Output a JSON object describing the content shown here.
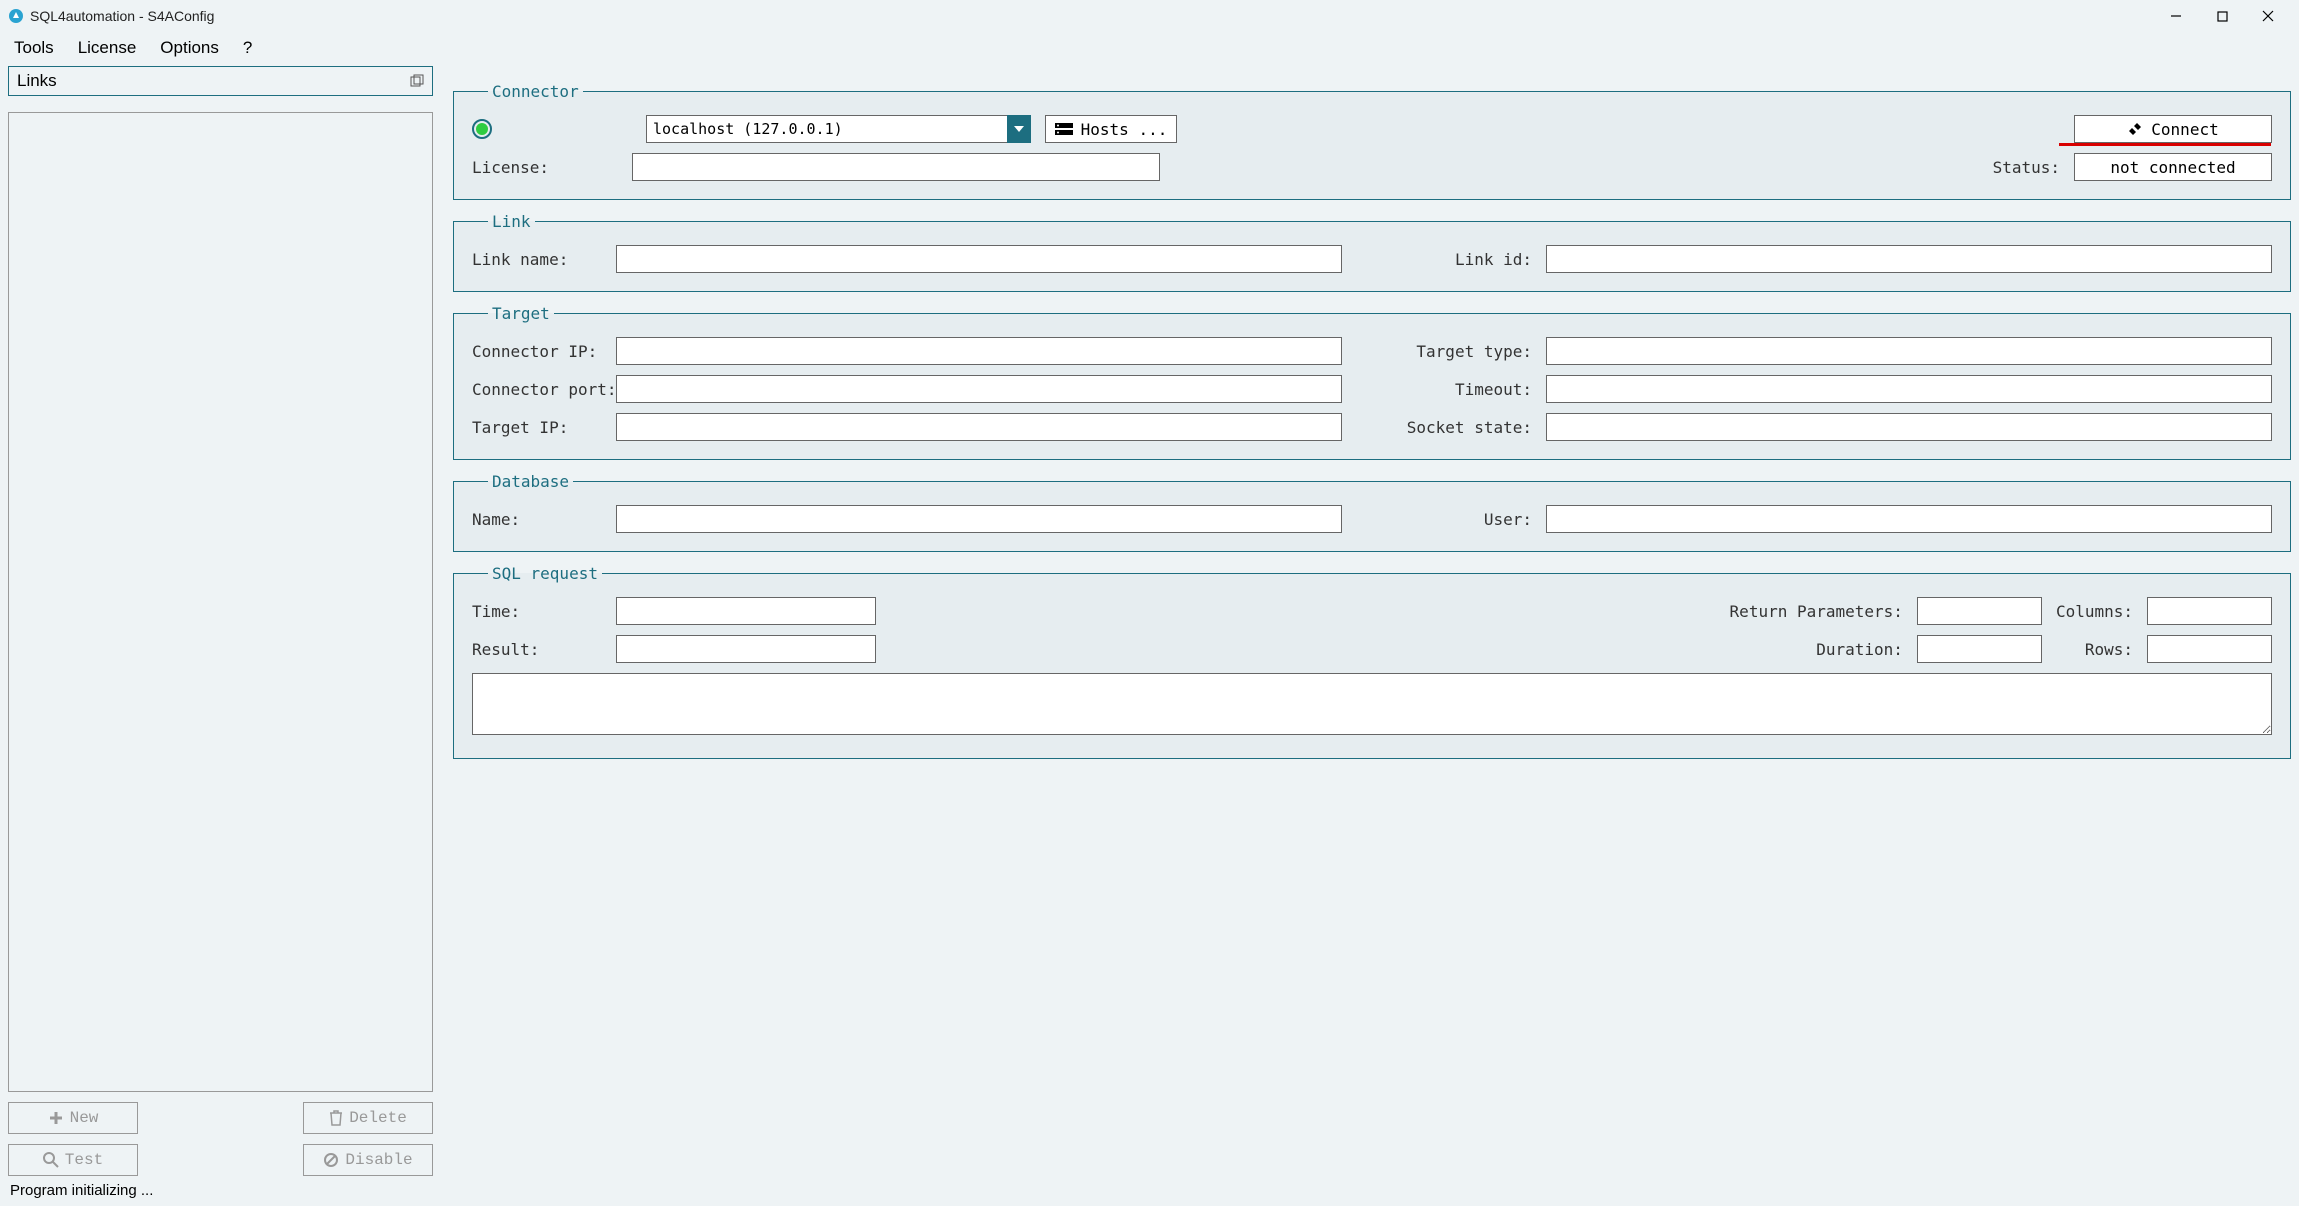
{
  "title": "SQL4automation - S4AConfig",
  "menu": {
    "tools": "Tools",
    "license": "License",
    "options": "Options",
    "help": "?"
  },
  "sidebar": {
    "header": "Links",
    "buttons": {
      "new": "New",
      "delete": "Delete",
      "test": "Test",
      "disable": "Disable"
    }
  },
  "connector": {
    "legend": "Connector",
    "host_value": "localhost (127.0.0.1)",
    "hosts_btn": "Hosts ...",
    "connect_btn": "Connect",
    "license_label": "License:",
    "license_value": "",
    "status_label": "Status:",
    "status_value": "not connected"
  },
  "link": {
    "legend": "Link",
    "name_label": "Link name:",
    "name_value": "",
    "id_label": "Link id:",
    "id_value": ""
  },
  "target": {
    "legend": "Target",
    "connector_ip_label": "Connector IP:",
    "connector_ip_value": "",
    "connector_port_label": "Connector port:",
    "connector_port_value": "",
    "target_ip_label": "Target IP:",
    "target_ip_value": "",
    "target_type_label": "Target type:",
    "target_type_value": "",
    "timeout_label": "Timeout:",
    "timeout_value": "",
    "socket_state_label": "Socket state:",
    "socket_state_value": ""
  },
  "database": {
    "legend": "Database",
    "name_label": "Name:",
    "name_value": "",
    "user_label": "User:",
    "user_value": ""
  },
  "sql": {
    "legend": "SQL request",
    "time_label": "Time:",
    "time_value": "",
    "result_label": "Result:",
    "result_value": "",
    "return_params_label": "Return Parameters:",
    "return_params_value": "",
    "duration_label": "Duration:",
    "duration_value": "",
    "columns_label": "Columns:",
    "columns_value": "",
    "rows_label": "Rows:",
    "rows_value": "",
    "text_value": ""
  },
  "statusbar": "Program initializing ..."
}
